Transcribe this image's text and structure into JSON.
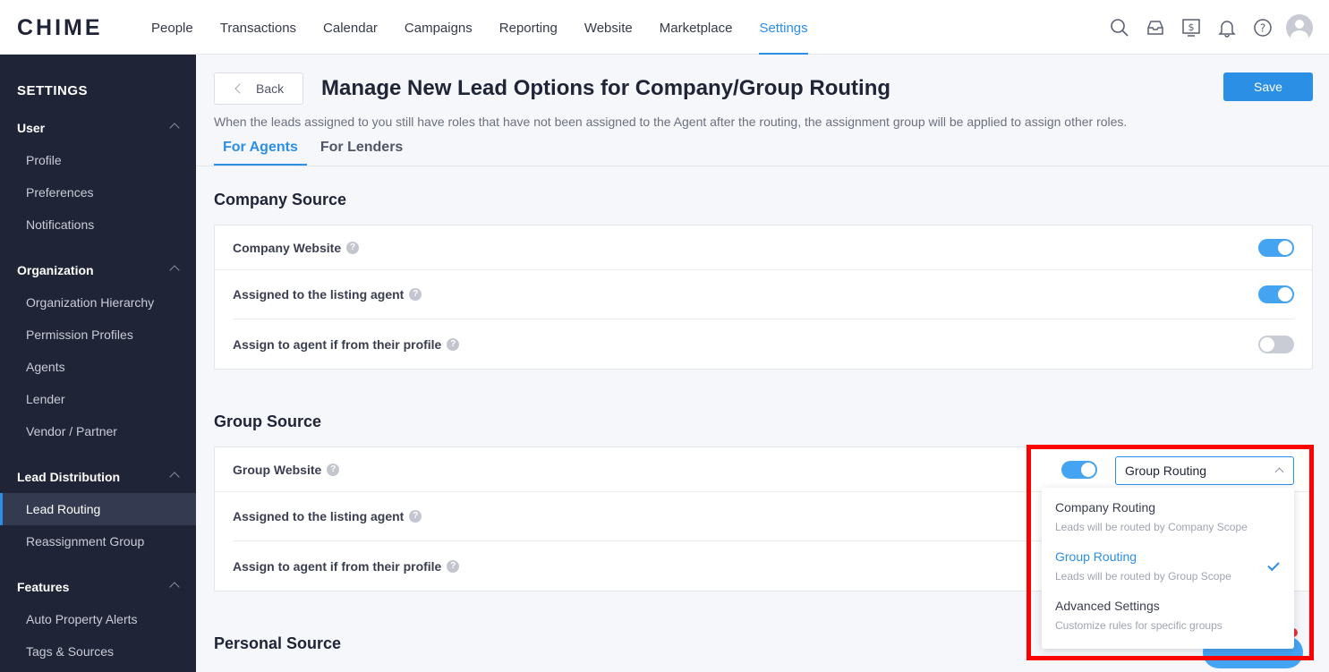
{
  "app": {
    "logo": "CHIME"
  },
  "nav": {
    "items": [
      "People",
      "Transactions",
      "Calendar",
      "Campaigns",
      "Reporting",
      "Website",
      "Marketplace",
      "Settings"
    ],
    "active": "Settings",
    "icons": [
      "search-icon",
      "inbox-icon",
      "dollar-icon",
      "bell-icon",
      "help-icon",
      "avatar"
    ]
  },
  "sidebar": {
    "title": "SETTINGS",
    "groups": [
      {
        "label": "User",
        "items": [
          "Profile",
          "Preferences",
          "Notifications"
        ]
      },
      {
        "label": "Organization",
        "items": [
          "Organization Hierarchy",
          "Permission Profiles",
          "Agents",
          "Lender",
          "Vendor / Partner"
        ]
      },
      {
        "label": "Lead Distribution",
        "items": [
          "Lead Routing",
          "Reassignment Group"
        ]
      },
      {
        "label": "Features",
        "items": [
          "Auto Property Alerts",
          "Tags & Sources"
        ]
      }
    ],
    "active_item": "Lead Routing"
  },
  "page": {
    "back_label": "Back",
    "title": "Manage New Lead Options for Company/Group Routing",
    "save_label": "Save",
    "subtitle": "When the leads assigned to you still have roles that have not been assigned to the Agent after the routing, the assignment group will be applied to assign other roles.",
    "tabs": [
      "For Agents",
      "For Lenders"
    ],
    "active_tab": "For Agents"
  },
  "company_source": {
    "title": "Company Source",
    "rows": [
      {
        "label": "Company Website",
        "enabled": true
      },
      {
        "label": "Assigned to the listing agent",
        "enabled": true
      },
      {
        "label": "Assign to agent if from their profile",
        "enabled": false
      }
    ]
  },
  "group_source": {
    "title": "Group Source",
    "rows": [
      {
        "label": "Group Website",
        "enabled": true
      },
      {
        "label": "Assigned to the listing agent"
      },
      {
        "label": "Assign to agent if from their profile"
      }
    ],
    "routing_select": {
      "value": "Group Routing",
      "options": [
        {
          "label": "Company Routing",
          "desc": "Leads will be routed by Company Scope"
        },
        {
          "label": "Group Routing",
          "desc": "Leads will be routed by Group Scope",
          "selected": true
        },
        {
          "label": "Advanced Settings",
          "desc": "Customize rules for specific groups"
        }
      ]
    }
  },
  "personal_source": {
    "title": "Personal Source"
  },
  "colors": {
    "accent": "#2b8fe6",
    "sidebar_bg": "#202437",
    "highlight": "#ff0000"
  }
}
